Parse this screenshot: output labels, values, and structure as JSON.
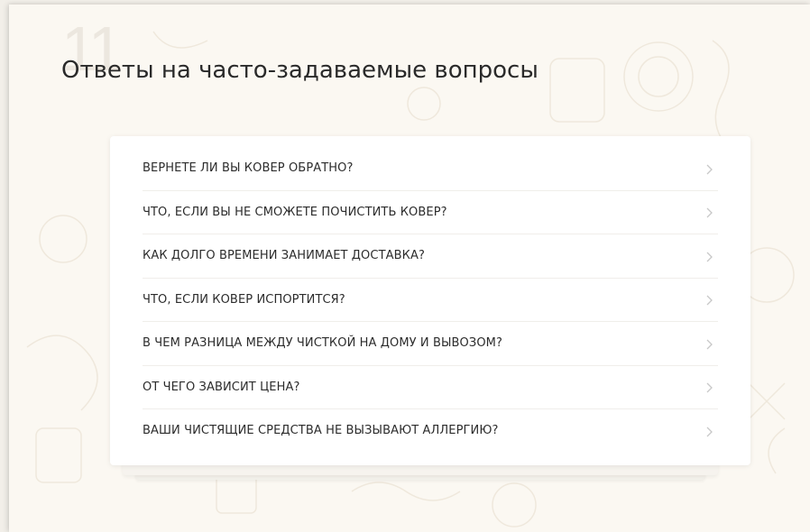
{
  "section": {
    "number": "11",
    "title": "Ответы на часто-задаваемые вопросы"
  },
  "faq": {
    "items": [
      {
        "question": "ВЕРНЕТЕ ЛИ ВЫ КОВЕР ОБРАТНО?",
        "icon": "chevron-right-icon"
      },
      {
        "question": "ЧТО, ЕСЛИ ВЫ НЕ СМОЖЕТЕ ПОЧИСТИТЬ КОВЕР?",
        "icon": "chevron-right-icon"
      },
      {
        "question": "КАК ДОЛГО ВРЕМЕНИ ЗАНИМАЕТ ДОСТАВКА?",
        "icon": "chevron-right-icon"
      },
      {
        "question": "ЧТО, ЕСЛИ КОВЕР ИСПОРТИТСЯ?",
        "icon": "chevron-right-icon"
      },
      {
        "question": "В ЧЕМ РАЗНИЦА МЕЖДУ ЧИСТКОЙ НА ДОМУ И ВЫВОЗОМ?",
        "icon": "chevron-right-icon"
      },
      {
        "question": "ОТ ЧЕГО ЗАВИСИТ ЦЕНА?",
        "icon": "chevron-right-icon"
      },
      {
        "question": "ВАШИ ЧИСТЯЩИЕ СРЕДСТВА НЕ ВЫЗЫВАЮТ АЛЛЕРГИЮ?",
        "icon": "chevron-right-icon"
      }
    ]
  },
  "colors": {
    "background": "#fbf8f2",
    "card": "#ffffff",
    "text": "#2c2c2c",
    "chevron": "#c8c8c8"
  }
}
